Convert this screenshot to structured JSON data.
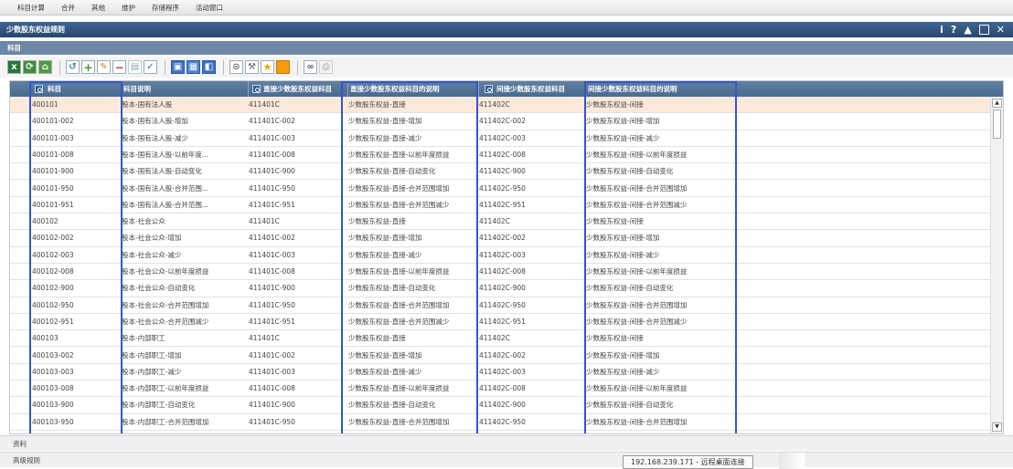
{
  "menubar": {
    "items": [
      "科目计算",
      "合并",
      "其他",
      "维护",
      "存储程序",
      "活动窗口"
    ]
  },
  "window": {
    "title": "少数股东权益规则",
    "tools": [
      "i",
      "?",
      "▲",
      "✕"
    ]
  },
  "section": {
    "title": "科目"
  },
  "grid": {
    "columns": [
      {
        "label": "科目",
        "sortable": true
      },
      {
        "label": "科目说明",
        "sortable": false
      },
      {
        "label": "直接少数股东权益科目",
        "sortable": true
      },
      {
        "label": "直接少数股东权益科目的说明",
        "sortable": false
      },
      {
        "label": "间接少数股东权益科目",
        "sortable": true
      },
      {
        "label": "间接少数股东权益科目的说明",
        "sortable": false
      }
    ],
    "selected_row": 0,
    "rows": [
      [
        "400101",
        "股本-国有法人股",
        "411401C",
        "少数股东权益-直接",
        "411402C",
        "少数股东权益-间接"
      ],
      [
        "400101-002",
        "股本-国有法人股-增加",
        "411401C-002",
        "少数股东权益-直接-增加",
        "411402C-002",
        "少数股东权益-间接-增加"
      ],
      [
        "400101-003",
        "股本-国有法人股-减少",
        "411401C-003",
        "少数股东权益-直接-减少",
        "411402C-003",
        "少数股东权益-间接-减少"
      ],
      [
        "400101-008",
        "股本-国有法人股-以前年度...",
        "411401C-008",
        "少数股东权益-直接-以前年度损益",
        "411402C-008",
        "少数股东权益-间接-以前年度损益"
      ],
      [
        "400101-900",
        "股本-国有法人股-自动变化",
        "411401C-900",
        "少数股东权益-直接-自动变化",
        "411402C-900",
        "少数股东权益-间接-自动变化"
      ],
      [
        "400101-950",
        "股本-国有法人股-合并范围...",
        "411401C-950",
        "少数股东权益-直接-合并范围增加",
        "411402C-950",
        "少数股东权益-间接-合并范围增加"
      ],
      [
        "400101-951",
        "股本-国有法人股-合并范围...",
        "411401C-951",
        "少数股东权益-直接-合并范围减少",
        "411402C-951",
        "少数股东权益-间接-合并范围减少"
      ],
      [
        "400102",
        "股本-社会公众",
        "411401C",
        "少数股东权益-直接",
        "411402C",
        "少数股东权益-间接"
      ],
      [
        "400102-002",
        "股本-社会公众-增加",
        "411401C-002",
        "少数股东权益-直接-增加",
        "411402C-002",
        "少数股东权益-间接-增加"
      ],
      [
        "400102-003",
        "股本-社会公众-减少",
        "411401C-003",
        "少数股东权益-直接-减少",
        "411402C-003",
        "少数股东权益-间接-减少"
      ],
      [
        "400102-008",
        "股本-社会公众-以前年度损益",
        "411401C-008",
        "少数股东权益-直接-以前年度损益",
        "411402C-008",
        "少数股东权益-间接-以前年度损益"
      ],
      [
        "400102-900",
        "股本-社会公众-自动变化",
        "411401C-900",
        "少数股东权益-直接-自动变化",
        "411402C-900",
        "少数股东权益-间接-自动变化"
      ],
      [
        "400102-950",
        "股本-社会公众-合并范围增加",
        "411401C-950",
        "少数股东权益-直接-合并范围增加",
        "411402C-950",
        "少数股东权益-间接-合并范围增加"
      ],
      [
        "400102-951",
        "股本-社会公众-合并范围减少",
        "411401C-951",
        "少数股东权益-直接-合并范围减少",
        "411402C-951",
        "少数股东权益-间接-合并范围减少"
      ],
      [
        "400103",
        "股本-内部职工",
        "411401C",
        "少数股东权益-直接",
        "411402C",
        "少数股东权益-间接"
      ],
      [
        "400103-002",
        "股本-内部职工-增加",
        "411401C-002",
        "少数股东权益-直接-增加",
        "411402C-002",
        "少数股东权益-间接-增加"
      ],
      [
        "400103-003",
        "股本-内部职工-减少",
        "411401C-003",
        "少数股东权益-直接-减少",
        "411402C-003",
        "少数股东权益-间接-减少"
      ],
      [
        "400103-008",
        "股本-内部职工-以前年度损益",
        "411401C-008",
        "少数股东权益-直接-以前年度损益",
        "411402C-008",
        "少数股东权益-间接-以前年度损益"
      ],
      [
        "400103-900",
        "股本-内部职工-自动变化",
        "411401C-900",
        "少数股东权益-直接-自动变化",
        "411402C-900",
        "少数股东权益-间接-自动变化"
      ],
      [
        "400103-950",
        "股本-内部职工-合并范围增加",
        "411401C-950",
        "少数股东权益-直接-合并范围增加",
        "411402C-950",
        "少数股东权益-间接-合并范围增加"
      ]
    ]
  },
  "bottom_panels": [
    "资利",
    "高级规则"
  ],
  "tooltip": "192.168.239.171 - 远程桌面连接",
  "colors": {
    "title_bar": "#2f5480",
    "header": "#56769b",
    "selected_row": "#fbe9dc",
    "highlight_box": "#3157c9"
  }
}
